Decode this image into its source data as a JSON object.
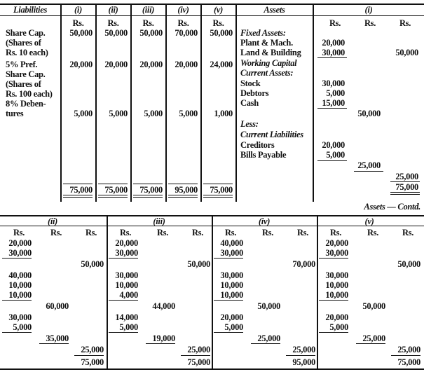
{
  "top": {
    "headers": {
      "liabilities": "Liabilities",
      "cols": [
        "(i)",
        "(ii)",
        "(iii)",
        "(iv)",
        "(v)"
      ],
      "assets": "Assets",
      "assets_col": "(i)"
    },
    "currency": "Rs.",
    "liability_rows": [
      {
        "label": [
          "Share Cap.",
          "(Shares of",
          "Rs. 10 each)"
        ],
        "values": [
          "50,000",
          "50,000",
          "50,000",
          "70,000",
          "50,000"
        ]
      },
      {
        "label": [
          "5% Pref.",
          "Share Cap.",
          "(Shares of",
          "Rs. 100 each)"
        ],
        "values": [
          "20,000",
          "20,000",
          "20,000",
          "20,000",
          "24,000"
        ]
      },
      {
        "label": [
          "8% Deben-",
          "tures"
        ],
        "values": [
          "5,000",
          "5,000",
          "5,000",
          "5,000",
          "1,000"
        ]
      }
    ],
    "liability_totals": [
      "75,000",
      "75,000",
      "75,000",
      "95,000",
      "75,000"
    ],
    "assets_rows": [
      {
        "label": "Fixed Assets:",
        "italic": true,
        "c1": "",
        "c2": "",
        "c3": ""
      },
      {
        "label": "Plant & Mach.",
        "c1": "20,000",
        "c2": "",
        "c3": ""
      },
      {
        "label": "Land & Building",
        "c1": "30,000",
        "c2": "",
        "c3": "50,000"
      },
      {
        "label": "Working Capital",
        "italic": true,
        "c1": "",
        "c2": "",
        "c3": ""
      },
      {
        "label": "Current Assets:",
        "italic": true,
        "c1": "",
        "c2": "",
        "c3": ""
      },
      {
        "label": "Stock",
        "c1": "30,000",
        "c2": "",
        "c3": ""
      },
      {
        "label": "Debtors",
        "c1": "5,000",
        "c2": "",
        "c3": ""
      },
      {
        "label": "Cash",
        "c1": "15,000",
        "c2": "",
        "c3": ""
      },
      {
        "label": "",
        "c1": "",
        "c2": "50,000",
        "c3": ""
      },
      {
        "label": "Less:",
        "italic": true,
        "c1": "",
        "c2": "",
        "c3": ""
      },
      {
        "label": "Current Liabilities",
        "italic": true,
        "c1": "",
        "c2": "",
        "c3": ""
      },
      {
        "label": "Creditors",
        "c1": "20,000",
        "c2": "",
        "c3": ""
      },
      {
        "label": "Bills Payable",
        "c1": "5,000",
        "c2": "",
        "c3": ""
      },
      {
        "label": "",
        "c1": "",
        "c2": "25,000",
        "c3": ""
      },
      {
        "label": "",
        "c1": "",
        "c2": "",
        "c3": "25,000"
      },
      {
        "label": "",
        "c1": "",
        "c2": "",
        "c3": "75,000"
      }
    ]
  },
  "contd_label": "Assets — Contd.",
  "bottom": {
    "sections": [
      {
        "header": "(ii)",
        "plant": "20,000",
        "land": "30,000",
        "fixed": "50,000",
        "stock": "40,000",
        "debtors": "10,000",
        "cash": "10,000",
        "ca": "60,000",
        "creditors": "30,000",
        "bills": "5,000",
        "cl": "35,000",
        "wc": "25,000",
        "total": "75,000"
      },
      {
        "header": "(iii)",
        "plant": "20,000",
        "land": "30,000",
        "fixed": "50,000",
        "stock": "30,000",
        "debtors": "10,000",
        "cash": "4,000",
        "ca": "44,000",
        "creditors": "14,000",
        "bills": "5,000",
        "cl": "19,000",
        "wc": "25,000",
        "total": "75,000"
      },
      {
        "header": "(iv)",
        "plant": "40,000",
        "land": "30,000",
        "fixed": "70,000",
        "stock": "30,000",
        "debtors": "10,000",
        "cash": "10,000",
        "ca": "50,000",
        "creditors": "20,000",
        "bills": "5,000",
        "cl": "25,000",
        "wc": "25,000",
        "total": "95,000"
      },
      {
        "header": "(v)",
        "plant": "20,000",
        "land": "30,000",
        "fixed": "50,000",
        "stock": "30,000",
        "debtors": "10,000",
        "cash": "10,000",
        "ca": "50,000",
        "creditors": "20,000",
        "bills": "5,000",
        "cl": "25,000",
        "wc": "25,000",
        "total": "75,000"
      }
    ]
  }
}
